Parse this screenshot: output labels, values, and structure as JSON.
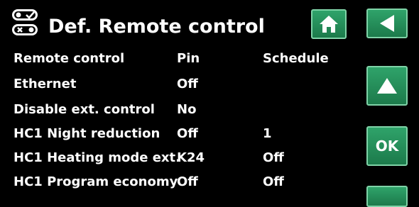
{
  "header": {
    "title": "Def. Remote control",
    "icon": "remote-toggle-icon"
  },
  "nav": {
    "home_icon": "home-icon",
    "back_icon": "back-arrow-icon",
    "up_icon": "up-arrow-icon",
    "ok_label": "OK"
  },
  "colors": {
    "button_green": "#1f8a55",
    "background": "#000000",
    "text": "#ffffff"
  },
  "table": {
    "rows": [
      {
        "name": "Remote control",
        "value": "Pin",
        "extra": "Schedule"
      },
      {
        "name": "Ethernet",
        "value": "Off",
        "extra": ""
      },
      {
        "name": "Disable ext. control",
        "value": "No",
        "extra": ""
      },
      {
        "name": "HC1 Night reduction",
        "value": "Off",
        "extra": "1"
      },
      {
        "name": "HC1 Heating mode ext.",
        "value": "K24",
        "extra": "Off"
      },
      {
        "name": "HC1 Program economy",
        "value": "Off",
        "extra": "Off"
      }
    ]
  }
}
